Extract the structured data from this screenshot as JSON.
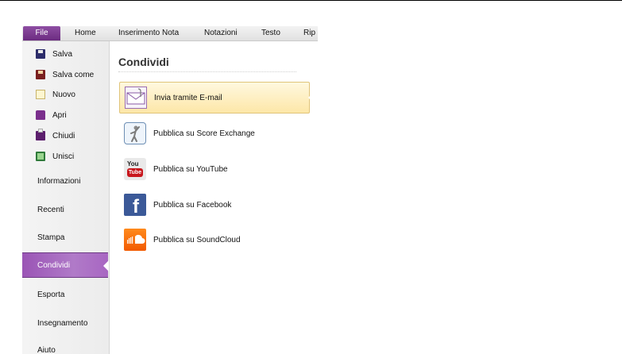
{
  "ribbon": {
    "tabs": [
      "File",
      "Home",
      "Inserimento Nota",
      "Notazioni",
      "Testo",
      "Rip"
    ]
  },
  "sidebar": {
    "small_items": [
      {
        "label": "Salva",
        "icon": "save-icon"
      },
      {
        "label": "Salva come",
        "icon": "save-as-icon"
      },
      {
        "label": "Nuovo",
        "icon": "new-document-icon"
      },
      {
        "label": "Apri",
        "icon": "open-folder-icon"
      },
      {
        "label": "Chiudi",
        "icon": "close-folder-icon"
      },
      {
        "label": "Unisci",
        "icon": "merge-icon"
      }
    ],
    "sections": [
      {
        "label": "Informazioni"
      },
      {
        "label": "Recenti"
      },
      {
        "label": "Stampa"
      },
      {
        "label": "Condividi",
        "active": true
      },
      {
        "label": "Esporta"
      },
      {
        "label": "Insegnamento"
      },
      {
        "label": "Aiuto"
      }
    ]
  },
  "content": {
    "title": "Condividi",
    "items": [
      {
        "label": "Invia tramite E-mail",
        "icon": "email-icon",
        "selected": true
      },
      {
        "label": "Pubblica su Score Exchange",
        "icon": "score-exchange-icon"
      },
      {
        "label": "Pubblica su YouTube",
        "icon": "youtube-icon",
        "icon_text_top": "You",
        "icon_text_bottom": "Tube"
      },
      {
        "label": "Pubblica su Facebook",
        "icon": "facebook-icon",
        "icon_text": "f"
      },
      {
        "label": "Pubblica su SoundCloud",
        "icon": "soundcloud-icon"
      }
    ]
  },
  "colors": {
    "file_tab": "#7a3a90",
    "active_section": "#a866c2",
    "selected_item": "#fde7a8",
    "facebook": "#3b5998",
    "youtube_red": "#c8171d",
    "soundcloud": "#f26f00"
  }
}
